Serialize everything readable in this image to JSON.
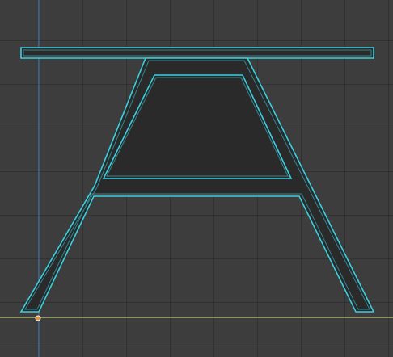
{
  "viewport": {
    "name": "3D Viewport",
    "view": "orthographic-front",
    "background_color": "#3d3d3d",
    "grid_color": "#333333"
  },
  "axes": {
    "x_axis_color": "#8a9c3c",
    "z_axis_color": "#3f87c9"
  },
  "object": {
    "shape": "A-frame table",
    "face_color": "#2a2a2a",
    "selection_outline_color": "#3ad0e0",
    "parts": [
      "tabletop",
      "left-leg",
      "right-leg",
      "crossbar",
      "top-bridge"
    ]
  },
  "origin": {
    "color": "#e8912f",
    "outline_color": "#f2f2f2"
  }
}
